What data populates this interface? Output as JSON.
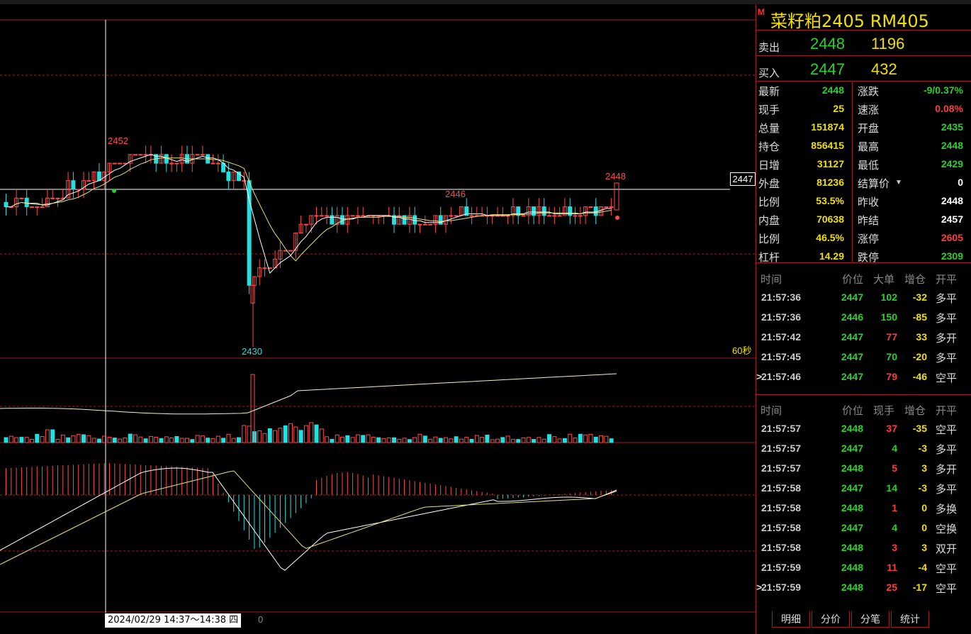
{
  "chart": {
    "price_tag": "2447",
    "high_label": "2452",
    "low_label": "2430",
    "mid_label": "2446",
    "last_label": "2448",
    "period_label": "60秒",
    "date_range": "2024/02/29 14:37～14:38 四",
    "zero_label": "0"
  },
  "panel": {
    "flag": "M",
    "title": "菜籽粕2405  RM405",
    "ask": {
      "label": "卖出",
      "price": "2448",
      "volume": "1196"
    },
    "bid": {
      "label": "买入",
      "price": "2447",
      "volume": "432"
    },
    "quote_left": [
      {
        "label": "最新",
        "value": "2448",
        "color": "#2ad12a"
      },
      {
        "label": "现手",
        "value": "25",
        "color": "#f0e000"
      },
      {
        "label": "总量",
        "value": "151874",
        "color": "#f0e000"
      },
      {
        "label": "持仓",
        "value": "856415",
        "color": "#f0e000"
      },
      {
        "label": "日增",
        "value": "31127",
        "color": "#f0e000"
      },
      {
        "label": "外盘",
        "value": "81236",
        "color": "#f0e000"
      },
      {
        "label": "比例",
        "value": "53.5%",
        "color": "#f0e000"
      },
      {
        "label": "内盘",
        "value": "70638",
        "color": "#f0e000"
      },
      {
        "label": "比例",
        "value": "46.5%",
        "color": "#f0e000"
      },
      {
        "label": "杠杆",
        "value": "14.29",
        "color": "#f0e000"
      }
    ],
    "quote_right": [
      {
        "label": "涨跌",
        "value": "-9/0.37%",
        "color": "#2ad12a"
      },
      {
        "label": "速涨",
        "value": "0.08%",
        "color": "#ff3b3b"
      },
      {
        "label": "开盘",
        "value": "2435",
        "color": "#2ad12a"
      },
      {
        "label": "最高",
        "value": "2448",
        "color": "#2ad12a"
      },
      {
        "label": "最低",
        "value": "2429",
        "color": "#2ad12a"
      },
      {
        "label": "结算价",
        "value": "0",
        "color": "#ffffff"
      },
      {
        "label": "昨收",
        "value": "2448",
        "color": "#ffffff"
      },
      {
        "label": "昨结",
        "value": "2457",
        "color": "#ffffff"
      },
      {
        "label": "涨停",
        "value": "2605",
        "color": "#ff3b3b"
      },
      {
        "label": "跌停",
        "value": "2309",
        "color": "#2ad12a"
      }
    ],
    "big_orders": {
      "headers": [
        "时间",
        "价位",
        "大单",
        "增仓",
        "开平"
      ],
      "rows": [
        {
          "time": "21:57:36",
          "price": "2447",
          "vol": "102",
          "vol_color": "#2ad12a",
          "chg": "-32",
          "type": "多平",
          "marker": ""
        },
        {
          "time": "21:57:36",
          "price": "2446",
          "vol": "150",
          "vol_color": "#2ad12a",
          "chg": "-85",
          "type": "多平",
          "marker": ""
        },
        {
          "time": "21:57:42",
          "price": "2447",
          "vol": "77",
          "vol_color": "#ff3b3b",
          "chg": "33",
          "type": "多开",
          "marker": ""
        },
        {
          "time": "21:57:45",
          "price": "2447",
          "vol": "70",
          "vol_color": "#2ad12a",
          "chg": "-20",
          "type": "多平",
          "marker": ""
        },
        {
          "time": "21:57:46",
          "price": "2447",
          "vol": "79",
          "vol_color": "#ff3b3b",
          "chg": "-46",
          "type": "空平",
          "marker": ">"
        }
      ]
    },
    "ticks": {
      "headers": [
        "时间",
        "价位",
        "现手",
        "增仓",
        "开平"
      ],
      "rows": [
        {
          "time": "21:57:57",
          "price": "2448",
          "vol": "37",
          "vol_color": "#ff3b3b",
          "chg": "-35",
          "type": "空平",
          "marker": ""
        },
        {
          "time": "21:57:57",
          "price": "2447",
          "vol": "4",
          "vol_color": "#2ad12a",
          "chg": "-3",
          "type": "多平",
          "marker": ""
        },
        {
          "time": "21:57:57",
          "price": "2448",
          "vol": "5",
          "vol_color": "#ff3b3b",
          "chg": "3",
          "type": "多开",
          "marker": ""
        },
        {
          "time": "21:57:58",
          "price": "2447",
          "vol": "14",
          "vol_color": "#2ad12a",
          "chg": "-3",
          "type": "多平",
          "marker": ""
        },
        {
          "time": "21:57:58",
          "price": "2448",
          "vol": "1",
          "vol_color": "#ff3b3b",
          "chg": "0",
          "type": "多换",
          "marker": ""
        },
        {
          "time": "21:57:58",
          "price": "2447",
          "vol": "4",
          "vol_color": "#2ad12a",
          "chg": "0",
          "type": "空换",
          "marker": ""
        },
        {
          "time": "21:57:58",
          "price": "2448",
          "vol": "3",
          "vol_color": "#ff3b3b",
          "chg": "3",
          "type": "双开",
          "marker": ""
        },
        {
          "time": "21:57:59",
          "price": "2448",
          "vol": "11",
          "vol_color": "#ff3b3b",
          "chg": "-4",
          "type": "空平",
          "marker": ""
        },
        {
          "time": "21:57:59",
          "price": "2448",
          "vol": "25",
          "vol_color": "#ff3b3b",
          "chg": "-17",
          "type": "空平",
          "marker": ">"
        }
      ]
    },
    "tabs": [
      "明细",
      "分价",
      "分笔",
      "统计"
    ]
  }
}
